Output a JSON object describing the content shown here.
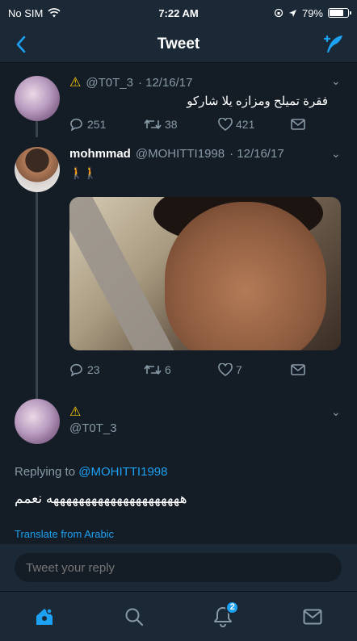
{
  "status": {
    "carrier": "No SIM",
    "time": "7:22 AM",
    "battery": "79%",
    "battery_level": 0.79
  },
  "nav": {
    "title": "Tweet"
  },
  "tweet1": {
    "handle": "@T0T_3",
    "date": "· 12/16/17",
    "text": "فقرة تميلح ومزازه يلا شاركو",
    "replies": "251",
    "retweets": "38",
    "likes": "421"
  },
  "tweet2": {
    "name": "mohmmad",
    "handle": "@MOHITTI1998",
    "date": "· 12/16/17",
    "text": "🚶🚶",
    "replies": "23",
    "retweets": "6",
    "likes": "7"
  },
  "tweet3": {
    "handle": "@T0T_3",
    "replying_prefix": "Replying to",
    "replying_to": "@MOHITTI1998",
    "text": "هههههههههههههههههههههه نعمم",
    "translate": "Translate from Arabic"
  },
  "reply": {
    "placeholder": "Tweet your reply"
  },
  "tabbar": {
    "notifications_badge": "2"
  },
  "colors": {
    "accent": "#1da1f2",
    "background": "#141d26",
    "bar": "#1b2836",
    "muted": "#8899a6"
  }
}
